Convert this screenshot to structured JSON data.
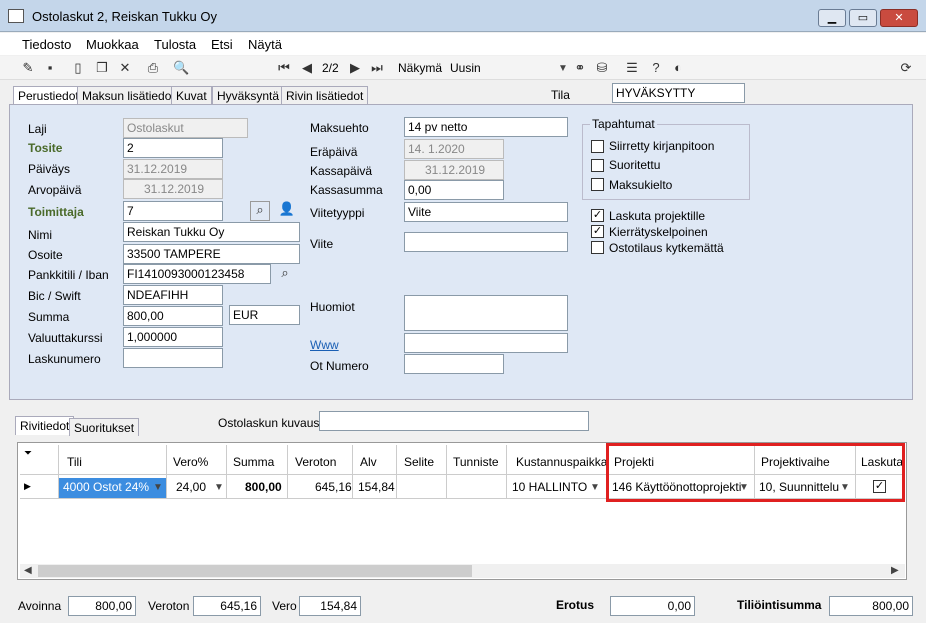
{
  "window": {
    "title": "Ostolaskut 2, Reiskan Tukku Oy"
  },
  "menu": [
    "Tiedosto",
    "Muokkaa",
    "Tulosta",
    "Etsi",
    "Näytä"
  ],
  "toolbar": {
    "record": "2/2",
    "view_label": "Näkymä",
    "view_value": "Uusin"
  },
  "tabs": [
    "Perustiedot",
    "Maksun lisätiedot",
    "Kuvat",
    "Hyväksyntä",
    "Rivin lisätiedot"
  ],
  "tila": {
    "label": "Tila",
    "value": "HYVÄKSYTTY"
  },
  "left": {
    "laji": {
      "label": "Laji",
      "value": "Ostolaskut"
    },
    "tosite": {
      "label": "Tosite",
      "value": "2"
    },
    "paivays": {
      "label": "Päiväys",
      "value": "31.12.2019"
    },
    "arvopaiva": {
      "label": "Arvopäivä",
      "value": "31.12.2019"
    },
    "toimittaja": {
      "label": "Toimittaja",
      "value": "7"
    },
    "nimi": {
      "label": "Nimi",
      "value": "Reiskan Tukku Oy"
    },
    "osoite": {
      "label": "Osoite",
      "value": "33500  TAMPERE"
    },
    "pankkitili": {
      "label": "Pankkitili / Iban",
      "value": "FI1410093000123458"
    },
    "bic": {
      "label": "Bic / Swift",
      "value": "NDEAFIHH"
    },
    "summa": {
      "label": "Summa",
      "value": "800,00",
      "currency": "EUR"
    },
    "valuuttakurssi": {
      "label": "Valuuttakurssi",
      "value": "1,000000"
    },
    "laskunumero": {
      "label": "Laskunumero",
      "value": ""
    }
  },
  "mid": {
    "maksuehto": {
      "label": "Maksuehto",
      "value": "14 pv netto"
    },
    "erapaiva": {
      "label": "Eräpäivä",
      "value": "14. 1.2020"
    },
    "kassapaiva": {
      "label": "Kassapäivä",
      "value": "31.12.2019"
    },
    "kassasumma": {
      "label": "Kassasumma",
      "value": "0,00"
    },
    "viitetyyppi": {
      "label": "Viitetyyppi",
      "value": "Viite"
    },
    "viite": {
      "label": "Viite",
      "value": ""
    },
    "huomiot": {
      "label": "Huomiot"
    },
    "www": {
      "label": "Www"
    },
    "otnumero": {
      "label": "Ot Numero"
    }
  },
  "tapahtumat": {
    "title": "Tapahtumat",
    "items": [
      "Siirretty kirjanpitoon",
      "Suoritettu",
      "Maksukielto"
    ]
  },
  "checks": [
    {
      "label": "Laskuta projektille",
      "checked": true
    },
    {
      "label": "Kierrätyskelpoinen",
      "checked": true
    },
    {
      "label": "Ostotilaus kytkemättä",
      "checked": false
    }
  ],
  "lower_tabs": [
    "Rivitiedot",
    "Suoritukset"
  ],
  "kuvaus_label": "Ostolaskun kuvaus",
  "grid": {
    "headers": [
      "Tili",
      "Vero%",
      "Summa",
      "Veroton",
      "Alv",
      "Selite",
      "Tunniste",
      "Kustannuspaikka",
      "Projekti",
      "Projektivaihe",
      "Laskuta"
    ],
    "row": {
      "tili": "4000 Ostot 24%",
      "vero": "24,00",
      "summa": "800,00",
      "veroton": "645,16",
      "alv": "154,84",
      "selite": "",
      "tunniste": "",
      "kustannuspaikka": "10 HALLINTO",
      "projekti": "146 Käyttöönottoprojekti",
      "projektivaihe": "10, Suunnittelu"
    }
  },
  "totals": {
    "avoinna_label": "Avoinna",
    "avoinna": "800,00",
    "veroton_label": "Veroton",
    "veroton": "645,16",
    "vero_label": "Vero",
    "vero": "154,84",
    "erotus_label": "Erotus",
    "erotus": "0,00",
    "tiliointi_label": "Tiliöintisumma",
    "tiliointi": "800,00"
  },
  "colors": {
    "highlight": "#e02020",
    "selected_cell": "#3c8de0"
  }
}
